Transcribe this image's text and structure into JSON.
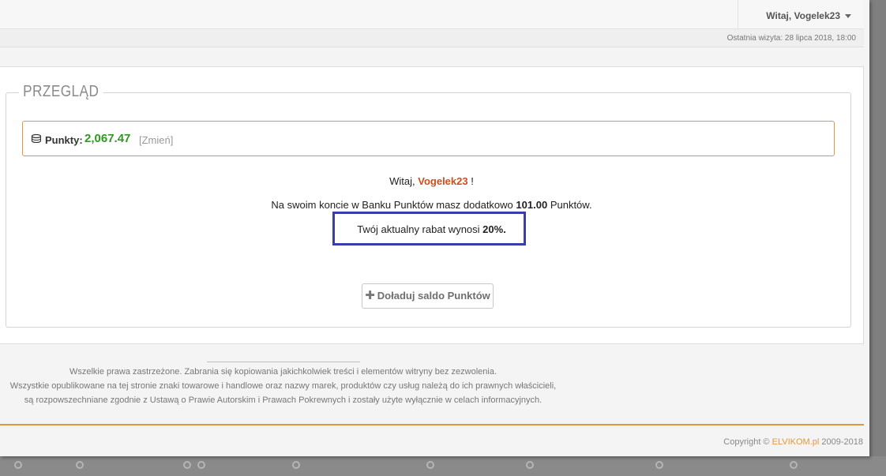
{
  "header": {
    "greeting": "Witaj, Vogelek23",
    "last_visit": "Ostatnia wizyta: 28 lipca 2018, 18:00"
  },
  "overview": {
    "title": "PRZEGLĄD",
    "points_label": "Punkty:",
    "points_value": "2,067.47",
    "change_link": "[Zmień]",
    "welcome_prefix": "Witaj,",
    "username": "Vogelek23",
    "welcome_suffix": "!",
    "balance_prefix": "Na swoim koncie w Banku Punktów masz dodatkowo",
    "balance_value": "101.00",
    "balance_suffix": "Punktów.",
    "discount_prefix": "Twój aktualny rabat wynosi",
    "discount_value": "20%.",
    "topup_button": "Doładuj saldo Punktów"
  },
  "footer": {
    "legal_line1": "Wszelkie prawa zastrzeżone. Zabrania się kopiowania jakichkolwiek treści i elementów witryny bez zezwolenia.",
    "legal_line2": "Wszystkie opublikowane na tej stronie znaki towarowe i handlowe oraz nazwy marek, produktów czy usług należą do ich prawnych właścicieli,",
    "legal_line3": "są rozpowszechniane zgodnie z Ustawą o Prawie Autorskim i Prawach Pokrewnych i zostały użyte wyłącznie w celach informacyjnych.",
    "copyright_prefix": "Copyright ©",
    "brand": "ELVIKOM.pl",
    "years": "2009-2018"
  },
  "colors": {
    "accent": "#e5963c",
    "points_green": "#2e9a1e",
    "username_red": "#d24b1d",
    "highlight_blue": "#3a3eab"
  },
  "icons": [
    "coins-icon",
    "caret-down-icon",
    "plus-icon"
  ]
}
